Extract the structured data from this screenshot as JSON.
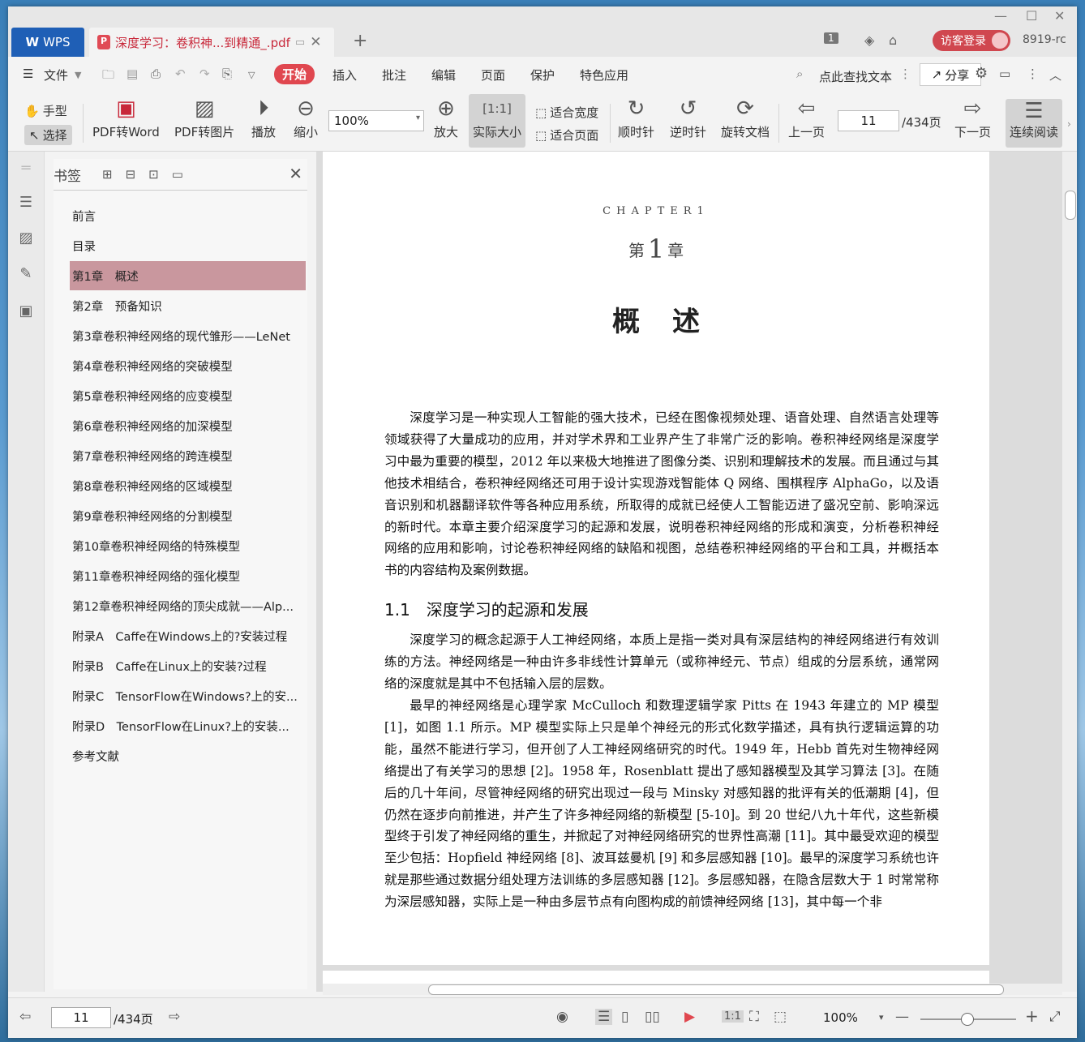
{
  "titlebar": {
    "app_tab": "WPS",
    "doc_tab": "深度学习：卷积神...到精通_.pdf",
    "login": "访客登录",
    "user_id": "8919-rc",
    "badge": "1"
  },
  "menubar": {
    "file": "文件",
    "items": [
      "开始",
      "插入",
      "批注",
      "编辑",
      "页面",
      "保护",
      "特色应用"
    ],
    "search": "点此查找文本",
    "share": "分享"
  },
  "toolbar": {
    "hand": "手型",
    "select": "选择",
    "pdf_to_word": "PDF转Word",
    "pdf_to_image": "PDF转图片",
    "play": "播放",
    "zoom_out": "缩小",
    "zoom_value": "100%",
    "zoom_in": "放大",
    "actual_size": "实际大小",
    "fit_width": "适合宽度",
    "fit_page": "适合页面",
    "clockwise": "顺时针",
    "counterclockwise": "逆时针",
    "rotate_doc": "旋转文档",
    "prev_page": "上一页",
    "page_value": "11",
    "page_total": "/434页",
    "next_page": "下一页",
    "continuous": "连续阅读"
  },
  "panel": {
    "title": "书签",
    "bookmarks": [
      {
        "label": "前言",
        "expandable": false,
        "active": false
      },
      {
        "label": "目录",
        "expandable": false,
        "active": false
      },
      {
        "label": "第1章　概述",
        "expandable": true,
        "active": true
      },
      {
        "label": "第2章　预备知识",
        "expandable": true,
        "active": false
      },
      {
        "label": "第3章卷积神经网络的现代雏形——LeNet",
        "expandable": true,
        "active": false
      },
      {
        "label": "第4章卷积神经网络的突破模型",
        "expandable": true,
        "active": false
      },
      {
        "label": "第5章卷积神经网络的应变模型",
        "expandable": true,
        "active": false
      },
      {
        "label": "第6章卷积神经网络的加深模型",
        "expandable": true,
        "active": false
      },
      {
        "label": "第7章卷积神经网络的跨连模型",
        "expandable": true,
        "active": false
      },
      {
        "label": "第8章卷积神经网络的区域模型",
        "expandable": true,
        "active": false
      },
      {
        "label": "第9章卷积神经网络的分割模型",
        "expandable": true,
        "active": false
      },
      {
        "label": "第10章卷积神经网络的特殊模型",
        "expandable": true,
        "active": false
      },
      {
        "label": "第11章卷积神经网络的强化模型",
        "expandable": true,
        "active": false
      },
      {
        "label": "第12章卷积神经网络的顶尖成就——Alp...",
        "expandable": true,
        "active": false
      },
      {
        "label": "附录A　Caffe在Windows上的?安装过程",
        "expandable": false,
        "active": false
      },
      {
        "label": "附录B　Caffe在Linux上的安装?过程",
        "expandable": false,
        "active": false
      },
      {
        "label": "附录C　TensorFlow在Windows?上的安...",
        "expandable": false,
        "active": false
      },
      {
        "label": "附录D　TensorFlow在Linux?上的安装...",
        "expandable": false,
        "active": false
      },
      {
        "label": "参考文献",
        "expandable": false,
        "active": false
      }
    ]
  },
  "document": {
    "chapter_label": "CHAPTER1",
    "chapter_prefix": "第",
    "chapter_number": "1",
    "chapter_suffix": "章",
    "chapter_title": "概述",
    "intro": "深度学习是一种实现人工智能的强大技术，已经在图像视频处理、语音处理、自然语言处理等领域获得了大量成功的应用，并对学术界和工业界产生了非常广泛的影响。卷积神经网络是深度学习中最为重要的模型，2012 年以来极大地推进了图像分类、识别和理解技术的发展。而且通过与其他技术相结合，卷积神经网络还可用于设计实现游戏智能体 Q 网络、围棋程序 AlphaGo，以及语音识别和机器翻译软件等各种应用系统，所取得的成就已经使人工智能迈进了盛况空前、影响深远的新时代。本章主要介绍深度学习的起源和发展，说明卷积神经网络的形成和演变，分析卷积神经网络的应用和影响，讨论卷积神经网络的缺陷和视图，总结卷积神经网络的平台和工具，并概括本书的内容结构及案例数据。",
    "section_title": "1.1　深度学习的起源和发展",
    "para1": "深度学习的概念起源于人工神经网络，本质上是指一类对具有深层结构的神经网络进行有效训练的方法。神经网络是一种由许多非线性计算单元（或称神经元、节点）组成的分层系统，通常网络的深度就是其中不包括输入层的层数。",
    "para2": "最早的神经网络是心理学家 McCulloch 和数理逻辑学家 Pitts 在 1943 年建立的 MP 模型 [1]，如图 1.1 所示。MP 模型实际上只是单个神经元的形式化数学描述，具有执行逻辑运算的功能，虽然不能进行学习，但开创了人工神经网络研究的时代。1949 年，Hebb 首先对生物神经网络提出了有关学习的思想 [2]。1958 年，Rosenblatt 提出了感知器模型及其学习算法 [3]。在随后的几十年间，尽管神经网络的研究出现过一段与 Minsky 对感知器的批评有关的低潮期 [4]，但仍然在逐步向前推进，并产生了许多神经网络的新模型 [5-10]。到 20 世纪八九十年代，这些新模型终于引发了神经网络的重生，并掀起了对神经网络研究的世界性高潮 [11]。其中最受欢迎的模型至少包括：Hopfield 神经网络 [8]、波耳兹曼机 [9] 和多层感知器 [10]。最早的深度学习系统也许就是那些通过数据分组处理方法训练的多层感知器 [12]。多层感知器，在隐含层数大于 1 时常常称为深层感知器，实际上是一种由多层节点有向图构成的前馈神经网络 [13]，其中每一个非"
  },
  "statusbar": {
    "page_value": "11",
    "page_total": "/434页",
    "zoom": "100%"
  }
}
